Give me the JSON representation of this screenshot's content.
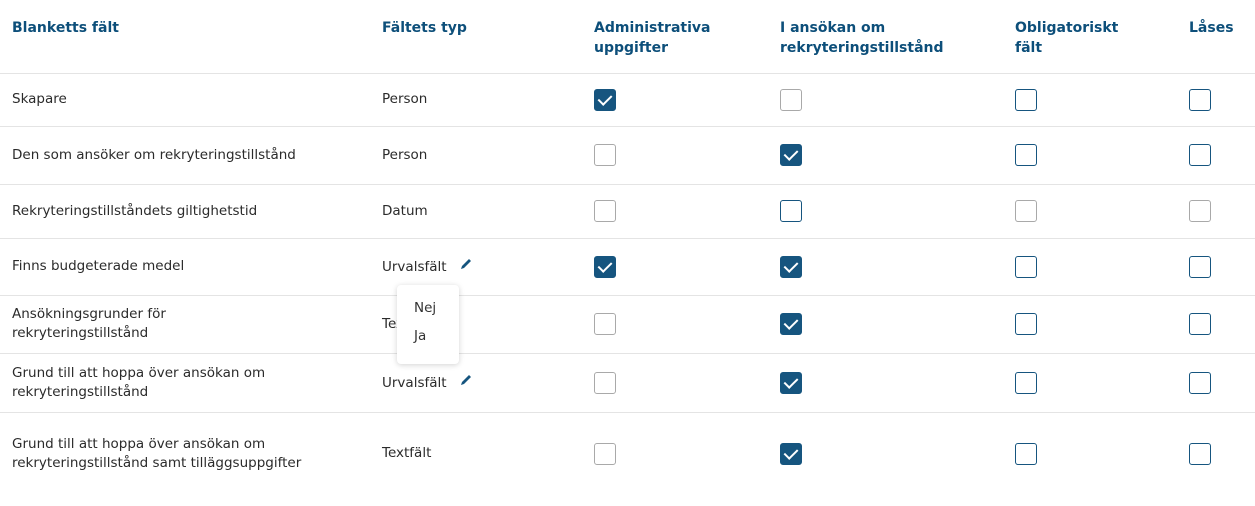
{
  "headers": {
    "field": "Blanketts fält",
    "type": "Fältets typ",
    "admin": "Administrativa uppgifter",
    "in_application": "I ansökan om rekryteringstillstånd",
    "mandatory": "Obligatoriskt fält",
    "locked": "Låses"
  },
  "rows": [
    {
      "name": "Skapare",
      "type": "Person",
      "admin": true,
      "in_application": false,
      "mandatory": false,
      "locked": false
    },
    {
      "name": "Den som ansöker om rekryteringstillstånd",
      "type": "Person",
      "admin": false,
      "in_application": true,
      "mandatory": false,
      "locked": false
    },
    {
      "name": "Rekryteringstillståndets giltighetstid",
      "type": "Datum",
      "admin": false,
      "in_application": false,
      "mandatory": false,
      "locked": false
    },
    {
      "name": "Finns budgeterade medel",
      "type": "Urvalsfält",
      "admin": true,
      "in_application": true,
      "mandatory": false,
      "locked": false
    },
    {
      "name": "Ansökningsgrunder för rekryteringstillstånd",
      "type": "Textfält",
      "admin": false,
      "in_application": true,
      "mandatory": false,
      "locked": false
    },
    {
      "name": "Grund till att hoppa över ansökan om rekryteringstillstånd",
      "type": "Urvalsfält",
      "admin": false,
      "in_application": true,
      "mandatory": false,
      "locked": false
    },
    {
      "name": "Grund till att hoppa över ansökan om rekryteringstillstånd samt tilläggsuppgifter",
      "type": "Textfält",
      "admin": false,
      "in_application": true,
      "mandatory": false,
      "locked": false
    }
  ],
  "popup": {
    "options": [
      "Nej",
      "Ja"
    ]
  },
  "colors": {
    "accent": "#16557f",
    "header_text": "#0d4f7a"
  }
}
